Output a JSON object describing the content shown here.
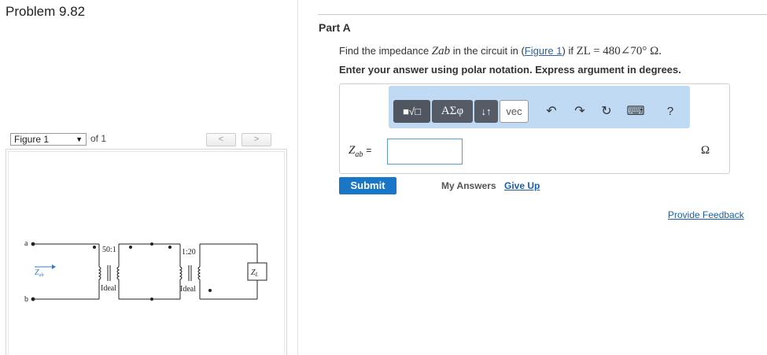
{
  "problem": {
    "title": "Problem 9.82"
  },
  "figure_nav": {
    "selected": "Figure 1",
    "of_label": "of 1",
    "prev_label": "<",
    "next_label": ">"
  },
  "circuit": {
    "terminal_a": "a",
    "terminal_b": "b",
    "zab_label": "Z",
    "zab_sub": "ab",
    "t1_ratio": "50:1",
    "t1_type": "Ideal",
    "t2_ratio": "1:20",
    "t2_type": "Ideal",
    "load_label": "Z",
    "load_sub": "L"
  },
  "part": {
    "label": "Part A",
    "question_before": "Find the impedance ",
    "question_var": "Zab",
    "question_mid": " in the circuit in (",
    "figure_link": "Figure 1",
    "question_after": ") if ",
    "question_load": "ZL = 480∠70° Ω.",
    "instruction": "Enter your answer using polar notation. Express argument in degrees."
  },
  "toolbar": {
    "templates": "■√□",
    "greek": "ΑΣφ",
    "arrows": "↓↑",
    "vec": "vec",
    "undo": "↶",
    "redo": "↷",
    "reset": "↻",
    "keyboard": "⌨",
    "help": "?"
  },
  "answer": {
    "label_main": "Z",
    "label_sub": "ab",
    "equals": "=",
    "value": "",
    "unit": "Ω"
  },
  "actions": {
    "submit": "Submit",
    "my_answers": "My Answers",
    "give_up": "Give Up",
    "provide_feedback": "Provide Feedback"
  },
  "colors": {
    "accent": "#1a76c6",
    "toolbar_bg": "#bfdaf2",
    "link": "#1a5fa8"
  }
}
